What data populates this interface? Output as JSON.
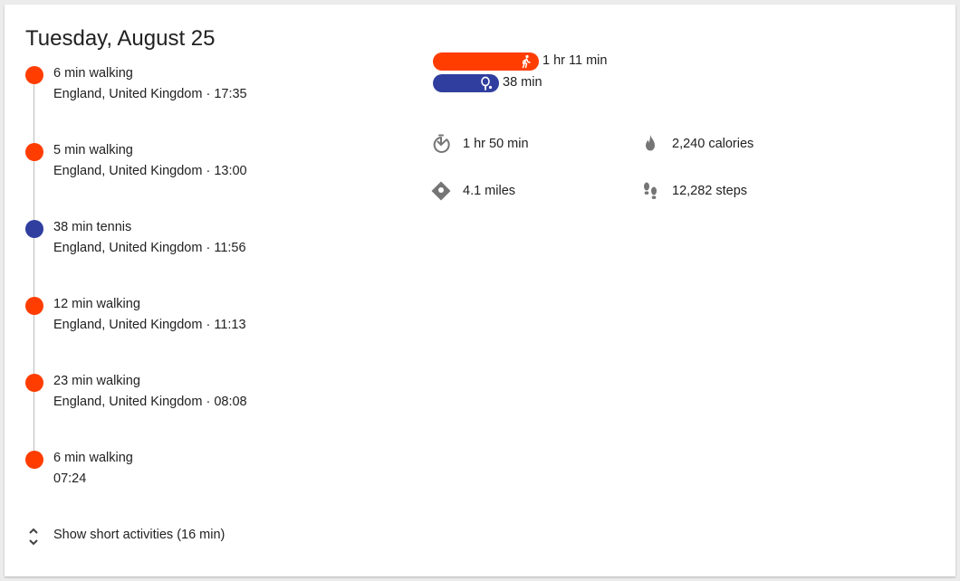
{
  "header": {
    "date": "Tuesday, August 25"
  },
  "colors": {
    "walking": "#ff3d00",
    "tennis": "#303f9f",
    "icon": "#757575",
    "line": "#bdbdbd"
  },
  "activities": [
    {
      "title": "6 min walking",
      "meta": "England, United Kingdom · 17:35",
      "type": "walking"
    },
    {
      "title": "5 min walking",
      "meta": "England, United Kingdom · 13:00",
      "type": "walking"
    },
    {
      "title": "38 min tennis",
      "meta": "England, United Kingdom · 11:56",
      "type": "tennis"
    },
    {
      "title": "12 min walking",
      "meta": "England, United Kingdom · 11:13",
      "type": "walking"
    },
    {
      "title": "23 min walking",
      "meta": "England, United Kingdom · 08:08",
      "type": "walking"
    },
    {
      "title": "6 min walking",
      "meta": "07:24",
      "type": "walking"
    }
  ],
  "short_activities": {
    "label": "Show short activities (16 min)",
    "icon": "unfold-chevrons-icon"
  },
  "summary_bars": [
    {
      "activity": "walking",
      "duration": "1 hr 11 min",
      "minutes": 71,
      "icon": "walking-person-icon"
    },
    {
      "activity": "tennis",
      "duration": "38 min",
      "minutes": 38,
      "icon": "tennis-racket-icon"
    }
  ],
  "stats": {
    "active_time": {
      "value": "1 hr 50 min",
      "icon": "timer-icon"
    },
    "calories": {
      "value": "2,240 calories",
      "icon": "flame-icon"
    },
    "distance": {
      "value": "4.1 miles",
      "icon": "directions-diamond-icon"
    },
    "steps": {
      "value": "12,282 steps",
      "icon": "footsteps-icon"
    }
  }
}
